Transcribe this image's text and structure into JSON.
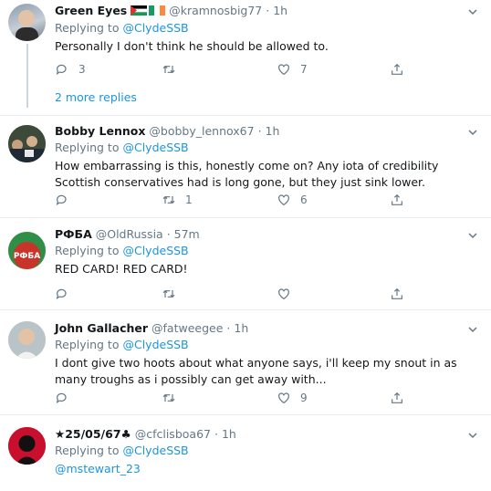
{
  "replying_label": "Replying to",
  "more_replies": "2 more replies",
  "tweets": [
    {
      "name": "Green Eyes",
      "handle": "@kramnosbig77",
      "dot": "·",
      "time": "1h",
      "reply_to": "@ClydeSSB",
      "text": "Personally I don't think he should be allowed to.",
      "replies": "3",
      "retweets": "",
      "likes": "7"
    },
    {
      "name": "Bobby Lennox",
      "handle": "@bobby_lennox67",
      "dot": "·",
      "time": "1h",
      "reply_to": "@ClydeSSB",
      "text": "How embarrassing is this, honestly come on? Any iota of credibility Scottish conservatives had is long gone, but they just sink lower.",
      "replies": "",
      "retweets": "1",
      "likes": "6"
    },
    {
      "name": "РФБА",
      "handle": "@OldRussia",
      "dot": "·",
      "time": "57m",
      "reply_to": "@ClydeSSB",
      "text": "RED CARD! RED CARD!",
      "replies": "",
      "retweets": "",
      "likes": "",
      "avatar_text": "РФБА"
    },
    {
      "name": "John Gallacher",
      "handle": "@fatweegee",
      "dot": "·",
      "time": "1h",
      "reply_to": "@ClydeSSB",
      "text": "I dont give two hoots about what anyone says, i'll keep my snout in as many troughs as i possibly can get away with...",
      "replies": "",
      "retweets": "",
      "likes": "9"
    },
    {
      "name": "★25/05/67♣",
      "handle": "@cfclisboa67",
      "dot": "·",
      "time": "1h",
      "reply_to": "@ClydeSSB",
      "text": "@mstewart_23",
      "replies": "",
      "retweets": "",
      "likes": ""
    }
  ],
  "colors": {
    "link": "#1b95e0",
    "muted": "#657786",
    "divider": "#e6ecf0"
  }
}
